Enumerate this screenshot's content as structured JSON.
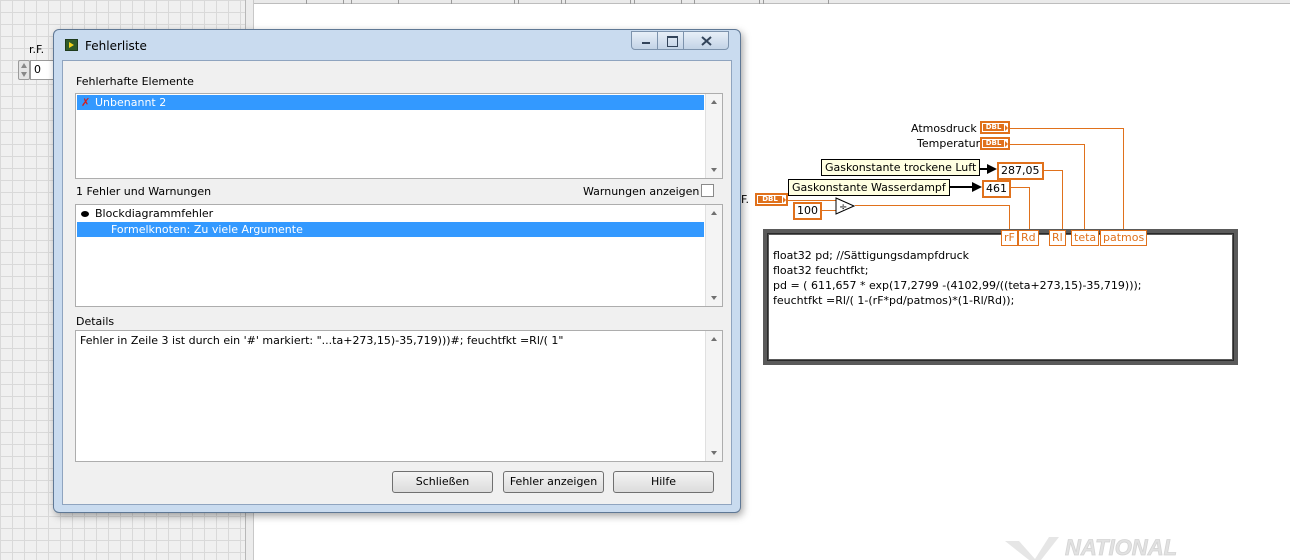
{
  "front_panel": {
    "rf_label": "r.F.",
    "rf_value": "0"
  },
  "dialog": {
    "title": "Fehlerliste",
    "items_section_label": "Fehlerhafte Elemente",
    "items": [
      {
        "label": "Unbenannt 2",
        "selected": true,
        "icon": "error-x-icon"
      }
    ],
    "errors_count_label": "1 Fehler und Warnungen",
    "show_warnings_label": "Warnungen anzeigen",
    "show_warnings_checked": false,
    "errors": [
      {
        "label": "Blockdiagrammfehler",
        "selected": false,
        "level": 0
      },
      {
        "label": "Formelknoten: Zu viele Argumente",
        "selected": true,
        "level": 1
      }
    ],
    "details_label": "Details",
    "details_text": "Fehler in Zeile 3 ist durch ein '#' markiert: \"...ta+273,15)-35,719)))#; feuchtfkt =Rl/( 1\"",
    "buttons": {
      "close": "Schließen",
      "show_error": "Fehler anzeigen",
      "help": "Hilfe"
    }
  },
  "block_diagram": {
    "terminal_type": "DBL",
    "atmosdruck_label": "Atmosdruck",
    "temperatur_label": "Temperatur",
    "rf_label_partial": "F.",
    "gas_dry_label": "Gaskonstante trockene Luft",
    "gas_dry_value": "287,05",
    "gas_wet_label": "Gaskonstante Wasserdampf",
    "gas_wet_value": "461",
    "const_100": "100",
    "formula_terms": [
      "rF",
      "Rd",
      "Rl",
      "teta",
      "patmos"
    ],
    "formula_lines": [
      "float32 pd;  //Sättigungsdampfdruck",
      "float32 feuchtfkt;",
      "pd = ( 611,657 * exp(17,2799 -(4102,99/((teta+273,15)-35,719)));",
      "feuchtfkt =Rl/( 1-(rF*pd/patmos)*(1-Rl/Rd));"
    ]
  },
  "watermark": {
    "text": "NATIONAL"
  }
}
